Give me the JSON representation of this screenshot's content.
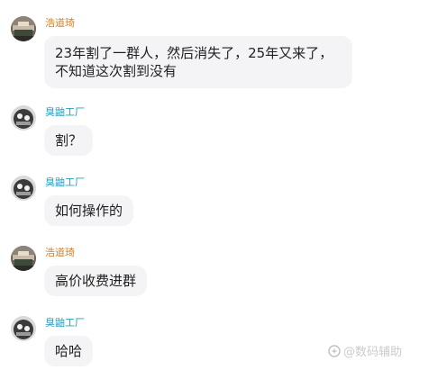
{
  "messages": [
    {
      "username": "浩道琦",
      "name_color": "#d0822d",
      "text": "23年割了一群人，然后消失了，25年又来了，不知道这次割到没有"
    },
    {
      "username": "臭鼬工厂",
      "name_color": "#2a9fc1",
      "text": "割？"
    },
    {
      "username": "臭鼬工厂",
      "name_color": "#2a9fc1",
      "text": "如何操作的"
    },
    {
      "username": "浩道琦",
      "name_color": "#d0822d",
      "text": "高价收费进群"
    },
    {
      "username": "臭鼬工厂",
      "name_color": "#2a9fc1",
      "text": "哈哈"
    }
  ],
  "watermark": {
    "text": "@数码辅助",
    "icon": "zhihu-logo-icon"
  },
  "colors": {
    "bubble_bg": "#f4f4f6",
    "text": "#1f1f1f"
  }
}
